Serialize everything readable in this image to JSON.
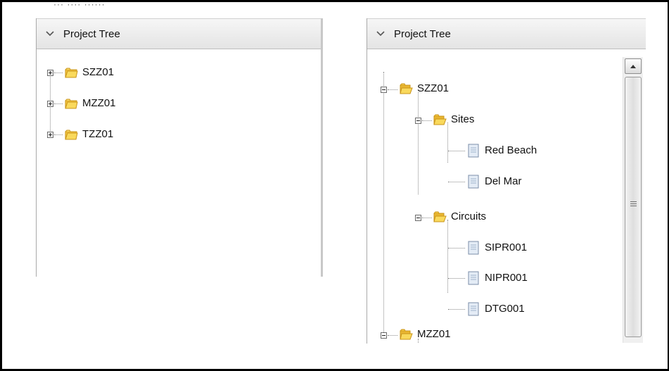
{
  "cutoff_text": "··· ···· ······",
  "left_panel": {
    "title": "Project Tree",
    "nodes": [
      {
        "label": "SZZ01",
        "state": "collapsed"
      },
      {
        "label": "MZZ01",
        "state": "collapsed"
      },
      {
        "label": "TZZ01",
        "state": "collapsed"
      }
    ]
  },
  "right_panel": {
    "title": "Project Tree",
    "nodes": [
      {
        "label": "SZZ01",
        "state": "expanded",
        "icon": "folder-open-icon"
      },
      {
        "label": "Sites",
        "state": "expanded",
        "icon": "folder-open-icon"
      },
      {
        "label": "Red Beach",
        "icon": "document-icon"
      },
      {
        "label": "Del Mar",
        "icon": "document-icon"
      },
      {
        "label": "Circuits",
        "state": "expanded",
        "icon": "folder-open-icon"
      },
      {
        "label": "SIPR001",
        "icon": "document-icon"
      },
      {
        "label": "NIPR001",
        "icon": "document-icon"
      },
      {
        "label": "DTG001",
        "icon": "document-icon"
      },
      {
        "label": "MZZ01",
        "state": "expanded",
        "icon": "folder-open-icon"
      }
    ]
  },
  "colors": {
    "folder": "#f2c43d",
    "folder_dark": "#c9941a",
    "document": "#e4ecf6",
    "header_bg": "#ececec"
  }
}
